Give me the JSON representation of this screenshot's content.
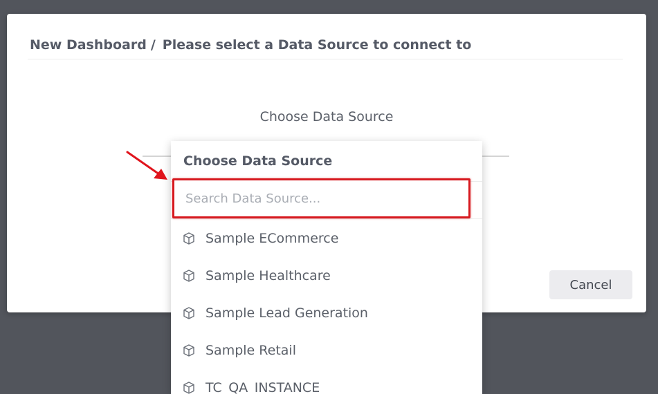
{
  "modal": {
    "breadcrumb_root": "New Dashboard",
    "breadcrumb_sep": "/",
    "breadcrumb_current": "Please select a Data Source to connect to",
    "choose_label": "Choose Data Source",
    "cancel_label": "Cancel"
  },
  "dropdown": {
    "title": "Choose Data Source",
    "search": {
      "placeholder": "Search Data Source...",
      "value": ""
    },
    "items": [
      {
        "label": "Sample ECommerce",
        "icon": "cube-icon"
      },
      {
        "label": "Sample Healthcare",
        "icon": "cube-icon"
      },
      {
        "label": "Sample Lead Generation",
        "icon": "cube-icon"
      },
      {
        "label": "Sample Retail",
        "icon": "cube-icon"
      },
      {
        "label": "TC_QA_INSTANCE",
        "icon": "cube-icon"
      }
    ]
  },
  "colors": {
    "overlay": "#52555c",
    "highlight": "#d7191f",
    "text": "#5b6069"
  }
}
